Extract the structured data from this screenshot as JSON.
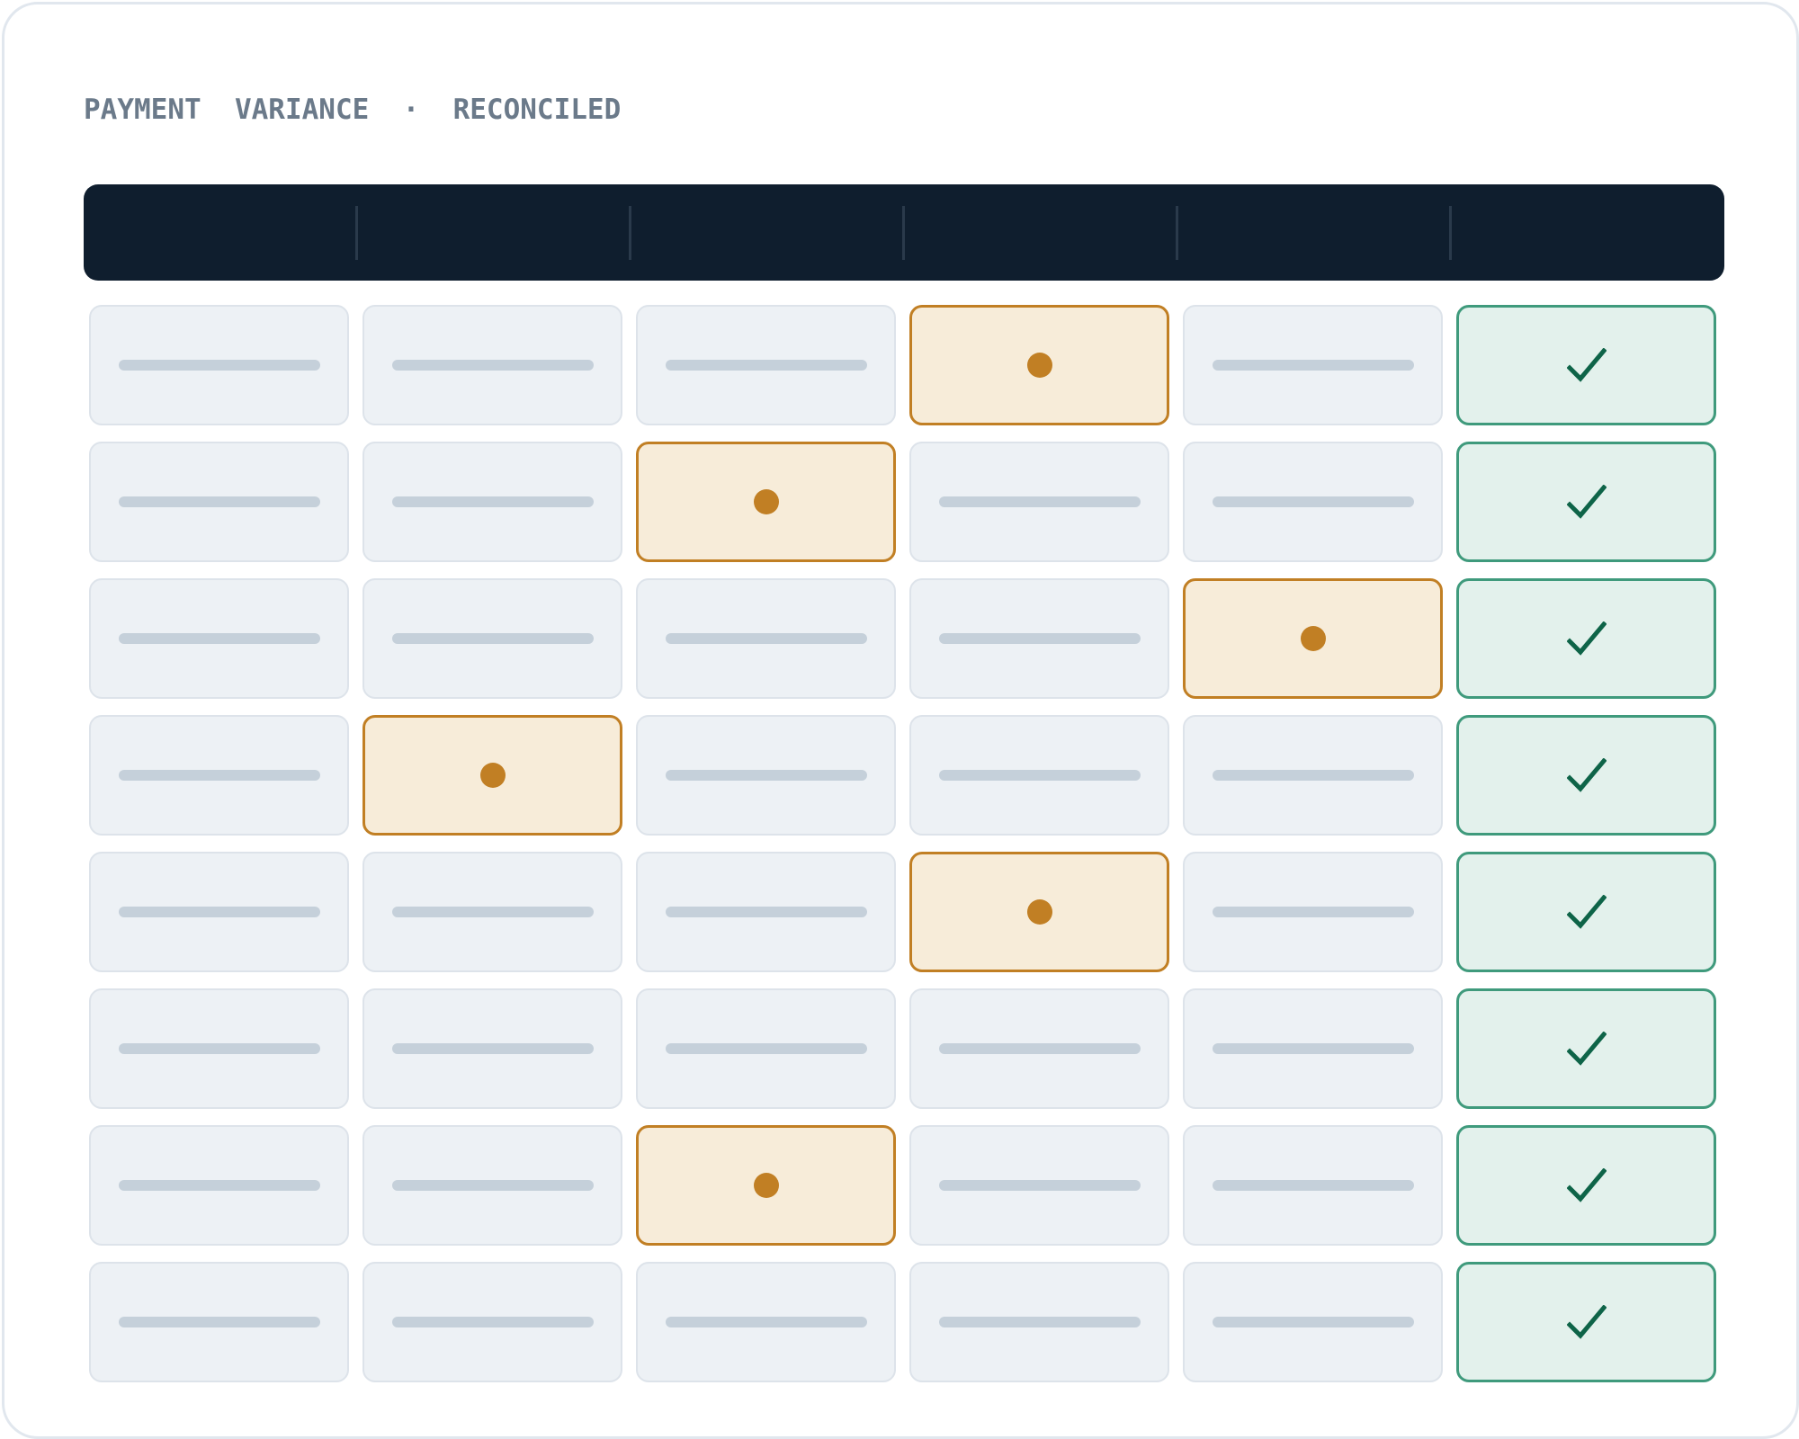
{
  "title": "PAYMENT  VARIANCE  ·  RECONCILED",
  "colors": {
    "header_background": "#0f1e2e",
    "cell_background": "#edf1f5",
    "placeholder_bar": "#c5d0da",
    "variance_border": "#c17f24",
    "variance_fill": "#f7ecd9",
    "reconciled_border": "#3f9a7c",
    "reconciled_fill": "#e3f1ec",
    "check_mark": "#0e6448"
  },
  "table": {
    "column_count": 6,
    "rows": [
      {
        "cells": [
          "placeholder",
          "placeholder",
          "placeholder",
          "variance",
          "placeholder",
          "reconciled"
        ]
      },
      {
        "cells": [
          "placeholder",
          "placeholder",
          "variance",
          "placeholder",
          "placeholder",
          "reconciled"
        ]
      },
      {
        "cells": [
          "placeholder",
          "placeholder",
          "placeholder",
          "placeholder",
          "variance",
          "reconciled"
        ]
      },
      {
        "cells": [
          "placeholder",
          "variance",
          "placeholder",
          "placeholder",
          "placeholder",
          "reconciled"
        ]
      },
      {
        "cells": [
          "placeholder",
          "placeholder",
          "placeholder",
          "variance",
          "placeholder",
          "reconciled"
        ]
      },
      {
        "cells": [
          "placeholder",
          "placeholder",
          "placeholder",
          "placeholder",
          "placeholder",
          "reconciled"
        ]
      },
      {
        "cells": [
          "placeholder",
          "placeholder",
          "variance",
          "placeholder",
          "placeholder",
          "reconciled"
        ]
      },
      {
        "cells": [
          "placeholder",
          "placeholder",
          "placeholder",
          "placeholder",
          "placeholder",
          "reconciled"
        ]
      }
    ]
  },
  "icons": {
    "variance": "variance-dot-icon",
    "reconciled": "checkmark-icon"
  }
}
